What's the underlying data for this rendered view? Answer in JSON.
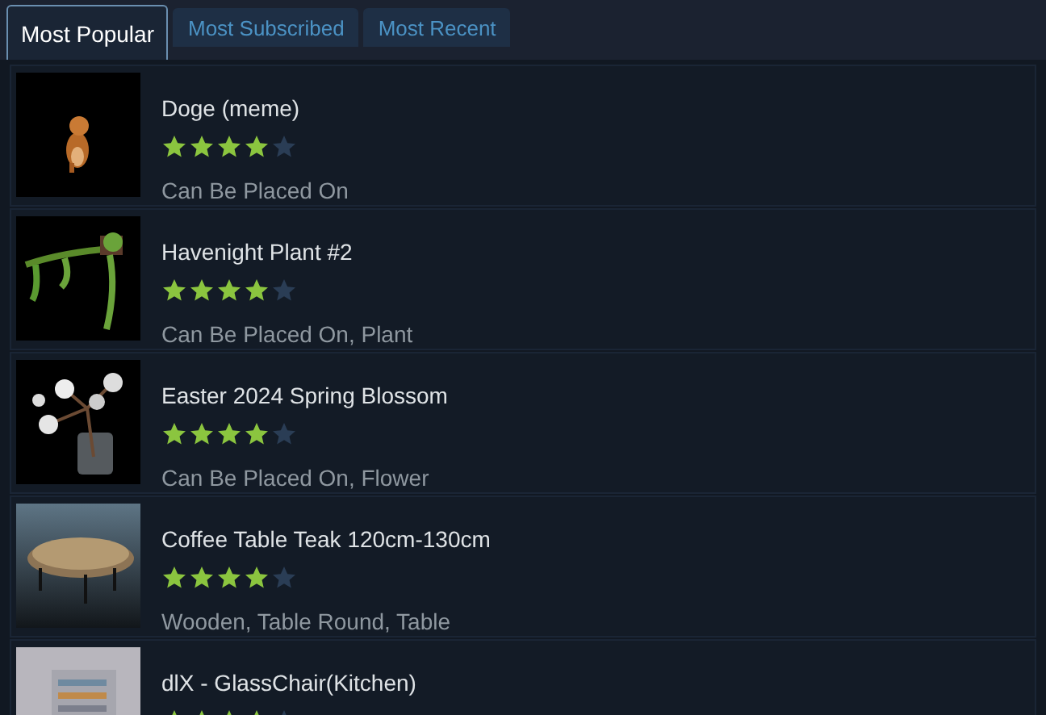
{
  "tabs": [
    {
      "label": "Most Popular",
      "selected": true
    },
    {
      "label": "Most Subscribed",
      "selected": false
    },
    {
      "label": "Most Recent",
      "selected": false
    }
  ],
  "items": [
    {
      "title": "Doge (meme)",
      "stars": 4,
      "tags": "Can Be Placed On"
    },
    {
      "title": "Havenight Plant #2",
      "stars": 4,
      "tags": "Can Be Placed On, Plant"
    },
    {
      "title": "Easter 2024 Spring Blossom",
      "stars": 4,
      "tags": "Can Be Placed On, Flower"
    },
    {
      "title": "Coffee Table Teak 120cm-130cm",
      "stars": 4,
      "tags": "Wooden, Table Round, Table"
    },
    {
      "title": "dlX - GlassChair(Kitchen)",
      "stars": 4
    }
  ]
}
